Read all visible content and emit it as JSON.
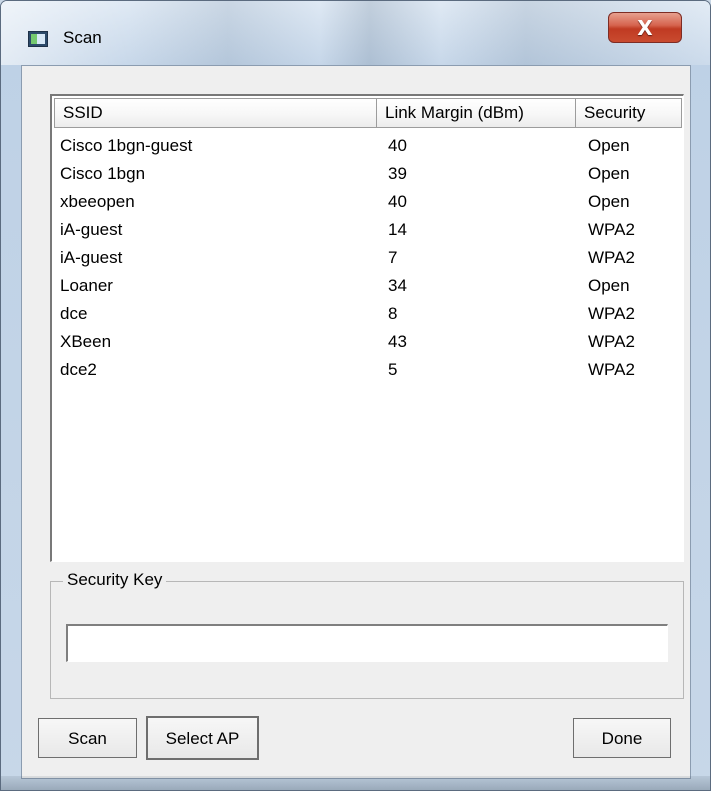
{
  "window": {
    "title": "Scan",
    "close_label": "X"
  },
  "list": {
    "columns": [
      "SSID",
      "Link Margin (dBm)",
      "Security"
    ],
    "rows": [
      {
        "ssid": "Cisco 1bgn-guest",
        "margin": "40",
        "security": "Open"
      },
      {
        "ssid": "Cisco 1bgn",
        "margin": "39",
        "security": "Open"
      },
      {
        "ssid": "xbeeopen",
        "margin": "40",
        "security": "Open"
      },
      {
        "ssid": "iA-guest",
        "margin": "14",
        "security": "WPA2"
      },
      {
        "ssid": "iA-guest",
        "margin": "7",
        "security": "WPA2"
      },
      {
        "ssid": "Loaner",
        "margin": "34",
        "security": "Open"
      },
      {
        "ssid": "dce",
        "margin": "8",
        "security": "WPA2"
      },
      {
        "ssid": "XBeen",
        "margin": "43",
        "security": "WPA2"
      },
      {
        "ssid": "dce2",
        "margin": "5",
        "security": "WPA2"
      }
    ]
  },
  "security": {
    "label": "Security Key",
    "value": ""
  },
  "buttons": {
    "scan": "Scan",
    "select_ap": "Select AP",
    "done": "Done"
  },
  "colors": {
    "window_frame": "#c5d6e9",
    "dialog_background": "#efefef",
    "close_button": "#c94b2f"
  },
  "icons": {
    "app": "scan-app-icon",
    "close": "close-icon"
  }
}
